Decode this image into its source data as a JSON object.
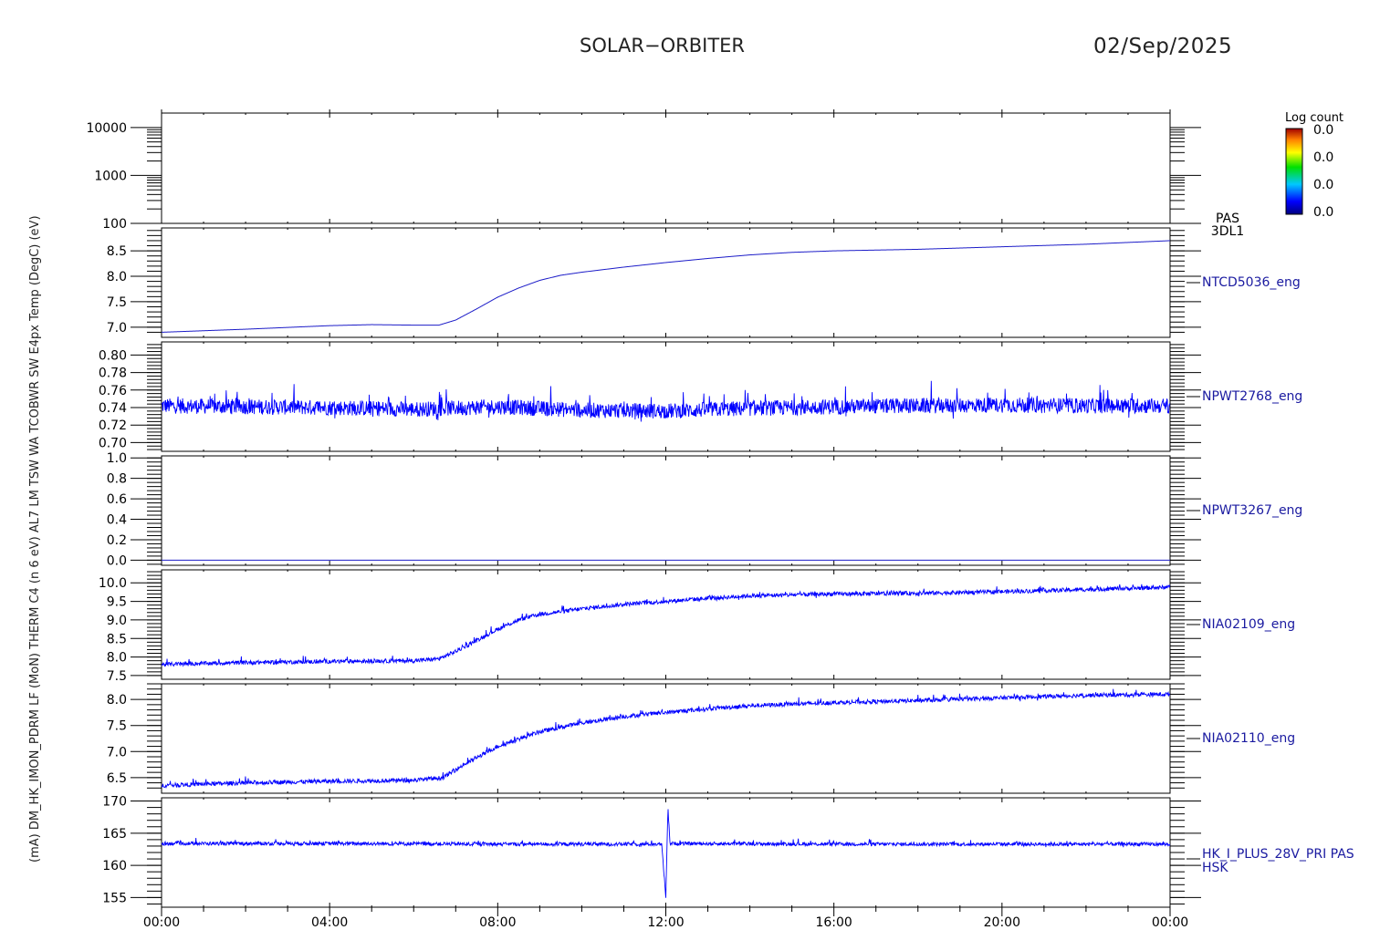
{
  "header": {
    "mission": "SOLAR−ORBITER",
    "date": "02/Sep/2025"
  },
  "colorbar": {
    "title": "Log count",
    "tick_labels": [
      "0.0",
      "0.0",
      "0.0",
      "0.0"
    ]
  },
  "yaxis_left_label": "(mA) DM_HK_IMON_PDRM LF (MoN) THERM C4 (n 6 eV) AL7 LM TSW WA TCOBWR SW E4px Temp (DegC) (eV)",
  "chart_data": {
    "type": "line",
    "time_axis": {
      "range_hours": [
        0,
        24
      ],
      "tick_hours": [
        0,
        4,
        8,
        12,
        16,
        20,
        24
      ],
      "tick_labels": [
        "00:00",
        "04:00",
        "08:00",
        "12:00",
        "16:00",
        "20:00",
        "00:00"
      ]
    },
    "panels": [
      {
        "id": "pas",
        "type": "heatmap",
        "scale": "log",
        "ylim": [
          100,
          20000
        ],
        "yticks": [
          100,
          1000,
          10000
        ],
        "ytick_labels": [
          "100",
          "1000",
          "10000"
        ],
        "right_label": [
          "PAS",
          "3DL1"
        ],
        "series": []
      },
      {
        "id": "ntcd5036",
        "ylim": [
          6.8,
          8.95
        ],
        "yticks": [
          7.0,
          7.5,
          8.0,
          8.5
        ],
        "ytick_labels": [
          "7.0",
          "7.5",
          "8.0",
          "8.5"
        ],
        "right_label": [
          "NTCD5036_eng"
        ],
        "noise": 0,
        "series": [
          {
            "x": [
              0,
              2,
              4,
              5,
              6,
              6.6,
              7,
              7.5,
              8,
              8.5,
              9,
              9.5,
              10,
              11,
              12,
              13,
              14,
              15,
              16,
              18,
              20,
              22,
              24
            ],
            "y": [
              6.9,
              6.96,
              7.03,
              7.05,
              7.04,
              7.04,
              7.14,
              7.36,
              7.59,
              7.77,
              7.92,
              8.02,
              8.08,
              8.18,
              8.27,
              8.35,
              8.42,
              8.47,
              8.5,
              8.53,
              8.58,
              8.63,
              8.7
            ]
          }
        ]
      },
      {
        "id": "npwt2768",
        "ylim": [
          0.69,
          0.815
        ],
        "yticks": [
          0.7,
          0.72,
          0.74,
          0.76,
          0.78,
          0.8
        ],
        "ytick_labels": [
          "0.70",
          "0.72",
          "0.74",
          "0.76",
          "0.78",
          "0.80"
        ],
        "right_label": [
          "NPWT2768_eng"
        ],
        "noise": 0.011,
        "series": [
          {
            "x": [
              0,
              2,
              4,
              6,
              8,
              10,
              12,
              14,
              16,
              18,
              20,
              22,
              24
            ],
            "y": [
              0.742,
              0.741,
              0.74,
              0.738,
              0.741,
              0.737,
              0.736,
              0.739,
              0.741,
              0.742,
              0.743,
              0.742,
              0.742
            ]
          }
        ]
      },
      {
        "id": "npwt3267",
        "ylim": [
          -0.05,
          1.02
        ],
        "yticks": [
          0.0,
          0.2,
          0.4,
          0.6,
          0.8,
          1.0
        ],
        "ytick_labels": [
          "0.0",
          "0.2",
          "0.4",
          "0.6",
          "0.8",
          "1.0"
        ],
        "right_label": [
          "NPWT3267_eng"
        ],
        "noise": 0,
        "series": [
          {
            "x": [
              0,
              24
            ],
            "y": [
              0.0,
              0.0
            ]
          }
        ]
      },
      {
        "id": "nia02109",
        "ylim": [
          7.4,
          10.35
        ],
        "yticks": [
          7.5,
          8.0,
          8.5,
          9.0,
          9.5,
          10.0
        ],
        "ytick_labels": [
          "7.5",
          "8.0",
          "8.5",
          "9.0",
          "9.5",
          "10.0"
        ],
        "right_label": [
          "NIA02109_eng"
        ],
        "noise": 0.07,
        "series": [
          {
            "x": [
              0,
              2,
              4,
              6,
              6.6,
              7,
              7.5,
              8,
              8.5,
              9,
              10,
              11,
              12,
              13,
              14,
              16,
              18,
              20,
              22,
              24
            ],
            "y": [
              7.8,
              7.85,
              7.88,
              7.9,
              7.95,
              8.15,
              8.45,
              8.75,
              9.0,
              9.15,
              9.3,
              9.42,
              9.5,
              9.58,
              9.65,
              9.7,
              9.72,
              9.76,
              9.82,
              9.88
            ]
          }
        ]
      },
      {
        "id": "nia02110",
        "ylim": [
          6.2,
          8.3
        ],
        "yticks": [
          6.5,
          7.0,
          7.5,
          8.0
        ],
        "ytick_labels": [
          "6.5",
          "7.0",
          "7.5",
          "8.0"
        ],
        "right_label": [
          "NIA02110_eng"
        ],
        "noise": 0.05,
        "series": [
          {
            "x": [
              0,
              2,
              4,
              6,
              6.7,
              7.2,
              8,
              9,
              10,
              11,
              12,
              13,
              14,
              16,
              18,
              20,
              22,
              24
            ],
            "y": [
              6.35,
              6.4,
              6.43,
              6.45,
              6.5,
              6.75,
              7.1,
              7.38,
              7.55,
              7.67,
              7.75,
              7.82,
              7.88,
              7.94,
              7.98,
              8.03,
              8.08,
              8.1
            ]
          }
        ]
      },
      {
        "id": "hk_i_plus_28v",
        "ylim": [
          153.5,
          170.5
        ],
        "yticks": [
          155,
          160,
          165,
          170
        ],
        "ytick_labels": [
          "155",
          "160",
          "165",
          "170"
        ],
        "right_label": [
          "HK_I_PLUS_28V_PRI PAS",
          "HSK"
        ],
        "noise": 0.35,
        "series": [
          {
            "x": [
              0,
              4,
              8,
              11.9,
              12.0,
              12.05,
              12.1,
              12.2,
              16,
              20,
              24
            ],
            "y": [
              163.4,
              163.4,
              163.3,
              163.3,
              155.2,
              169.0,
              163.4,
              163.4,
              163.3,
              163.3,
              163.3
            ]
          }
        ]
      }
    ]
  }
}
